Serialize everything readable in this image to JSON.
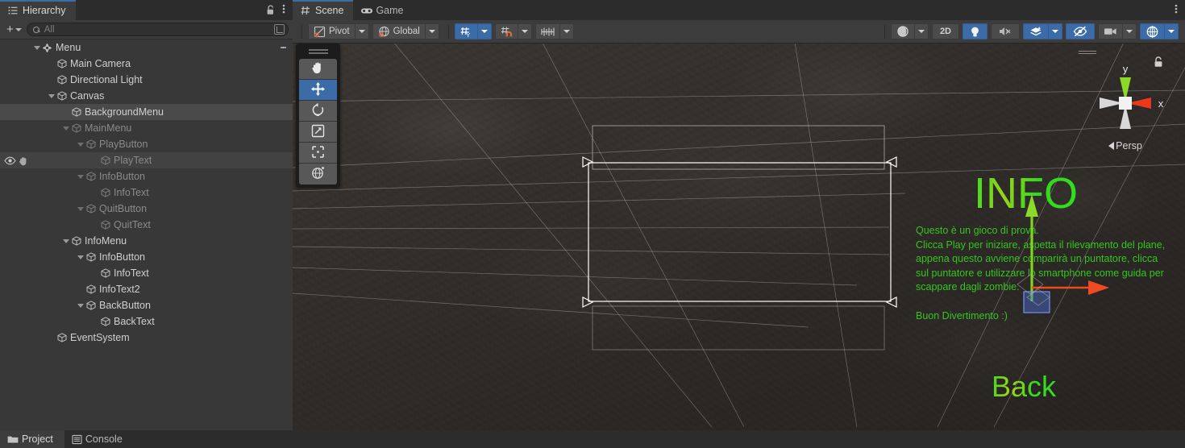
{
  "hierarchy": {
    "tab_label": "Hierarchy",
    "lock_icon": "lock-icon",
    "menu_icon": "kebab-menu-icon",
    "toolbar": {
      "add_label": "+",
      "search_placeholder": "All",
      "search_value": "",
      "search_icon": "search-icon",
      "expand_icon": "expand-search-icon"
    },
    "items": [
      {
        "label": "Menu",
        "depth": 0,
        "expanded": true,
        "icon": "unity-prefab-icon",
        "dim": false,
        "selected": false,
        "kebab": true
      },
      {
        "label": "Main Camera",
        "depth": 1,
        "expanded": null,
        "icon": "gameobject-icon",
        "dim": false,
        "selected": false,
        "kebab": false
      },
      {
        "label": "Directional Light",
        "depth": 1,
        "expanded": null,
        "icon": "gameobject-icon",
        "dim": false,
        "selected": false,
        "kebab": false
      },
      {
        "label": "Canvas",
        "depth": 1,
        "expanded": true,
        "icon": "gameobject-icon",
        "dim": false,
        "selected": false,
        "kebab": false
      },
      {
        "label": "BackgroundMenu",
        "depth": 2,
        "expanded": null,
        "icon": "gameobject-icon",
        "dim": false,
        "selected": true,
        "kebab": false
      },
      {
        "label": "MainMenu",
        "depth": 2,
        "expanded": true,
        "icon": "gameobject-icon",
        "dim": true,
        "selected": false,
        "kebab": false
      },
      {
        "label": "PlayButton",
        "depth": 3,
        "expanded": true,
        "icon": "gameobject-icon",
        "dim": true,
        "selected": false,
        "kebab": false
      },
      {
        "label": "PlayText",
        "depth": 4,
        "expanded": null,
        "icon": "gameobject-icon",
        "dim": true,
        "selected": false,
        "kebab": false,
        "hovered": true,
        "visibility": true
      },
      {
        "label": "InfoButton",
        "depth": 3,
        "expanded": true,
        "icon": "gameobject-icon",
        "dim": true,
        "selected": false,
        "kebab": false
      },
      {
        "label": "InfoText",
        "depth": 4,
        "expanded": null,
        "icon": "gameobject-icon",
        "dim": true,
        "selected": false,
        "kebab": false
      },
      {
        "label": "QuitButton",
        "depth": 3,
        "expanded": true,
        "icon": "gameobject-icon",
        "dim": true,
        "selected": false,
        "kebab": false
      },
      {
        "label": "QuitText",
        "depth": 4,
        "expanded": null,
        "icon": "gameobject-icon",
        "dim": true,
        "selected": false,
        "kebab": false
      },
      {
        "label": "InfoMenu",
        "depth": 2,
        "expanded": true,
        "icon": "gameobject-icon",
        "dim": false,
        "selected": false,
        "kebab": false
      },
      {
        "label": "InfoButton",
        "depth": 3,
        "expanded": true,
        "icon": "gameobject-icon",
        "dim": false,
        "selected": false,
        "kebab": false
      },
      {
        "label": "InfoText",
        "depth": 4,
        "expanded": null,
        "icon": "gameobject-icon",
        "dim": false,
        "selected": false,
        "kebab": false
      },
      {
        "label": "InfoText2",
        "depth": 3,
        "expanded": null,
        "icon": "gameobject-icon",
        "dim": false,
        "selected": false,
        "kebab": false
      },
      {
        "label": "BackButton",
        "depth": 3,
        "expanded": true,
        "icon": "gameobject-icon",
        "dim": false,
        "selected": false,
        "kebab": false
      },
      {
        "label": "BackText",
        "depth": 4,
        "expanded": null,
        "icon": "gameobject-icon",
        "dim": false,
        "selected": false,
        "kebab": false
      },
      {
        "label": "EventSystem",
        "depth": 1,
        "expanded": null,
        "icon": "gameobject-icon",
        "dim": false,
        "selected": false,
        "kebab": false
      }
    ]
  },
  "scene_panel": {
    "tabs": [
      {
        "label": "Scene",
        "icon": "scene-grid-icon",
        "active": true
      },
      {
        "label": "Game",
        "icon": "gamepad-icon",
        "active": false
      }
    ],
    "overflow_icon": "kebab-menu-icon",
    "toolbar": {
      "pivot_label": "Pivot",
      "pivot_icon": "pivot-icon",
      "handle_label": "Global",
      "handle_icon": "globe-icon",
      "grid_snap_icon": "grid-axis-y-icon",
      "grid_snap_active": true,
      "magnet_snap_icon": "magnet-snap-icon",
      "magnet_snap_active": false,
      "increment_snap_icon": "increment-snap-icon",
      "increment_snap_active": false
    },
    "right_toolbar": [
      {
        "name": "shading-mode",
        "icon": "sphere-shading-icon",
        "active": false,
        "has_dropdown": true,
        "label": ""
      },
      {
        "name": "2d-toggle",
        "icon": "text-2d",
        "active": false,
        "has_dropdown": false,
        "label": "2D"
      },
      {
        "name": "lighting-toggle",
        "icon": "lightbulb-icon",
        "active": true,
        "has_dropdown": false,
        "label": ""
      },
      {
        "name": "audio-toggle",
        "icon": "speaker-mute-icon",
        "active": false,
        "has_dropdown": false,
        "label": ""
      },
      {
        "name": "effects-toggle",
        "icon": "fx-layers-icon",
        "active": true,
        "has_dropdown": true,
        "label": ""
      },
      {
        "name": "hidden-objects-toggle",
        "icon": "eye-slash-icon",
        "active": true,
        "has_dropdown": false,
        "label": ""
      },
      {
        "name": "scene-camera",
        "icon": "camera-icon",
        "active": false,
        "has_dropdown": true,
        "label": ""
      },
      {
        "name": "gizmos-toggle",
        "icon": "gizmos-globe-icon",
        "active": true,
        "has_dropdown": true,
        "label": ""
      }
    ],
    "tools": [
      {
        "name": "hand-tool",
        "icon": "hand-icon",
        "active": false
      },
      {
        "name": "move-tool",
        "icon": "move-arrows-icon",
        "active": true
      },
      {
        "name": "rotate-tool",
        "icon": "rotate-icon",
        "active": false
      },
      {
        "name": "scale-tool",
        "icon": "scale-icon",
        "active": false
      },
      {
        "name": "rect-tool",
        "icon": "rect-transform-icon",
        "active": false
      },
      {
        "name": "transform-tool",
        "icon": "transform-globe-icon",
        "active": false
      }
    ],
    "gizmo": {
      "axis_y": "y",
      "axis_x": "x",
      "projection_label": "Persp",
      "lock_icon": "lock-icon"
    }
  },
  "scene_content": {
    "info_title": "INFO",
    "info_body": "Questo è un gioco di prova.\nClicca Play per iniziare, aspetta il rilevamento del plane, appena questo avviene comparirà un puntatore, clicca sul puntatore e utilizzare lo smartphone come guida per scappare dagli zombie.\n\nBuon Divertimento :)",
    "back_label": "Back",
    "accent_green": "#3fe02a",
    "gizmo_y_color": "#7fd420",
    "gizmo_x_color": "#f04a20",
    "gizmo_z_color": "#4a6fd8"
  },
  "bottom_bar": {
    "tabs": [
      {
        "label": "Project",
        "icon": "folder-icon",
        "active": true
      },
      {
        "label": "Console",
        "icon": "console-icon",
        "active": false
      }
    ]
  }
}
